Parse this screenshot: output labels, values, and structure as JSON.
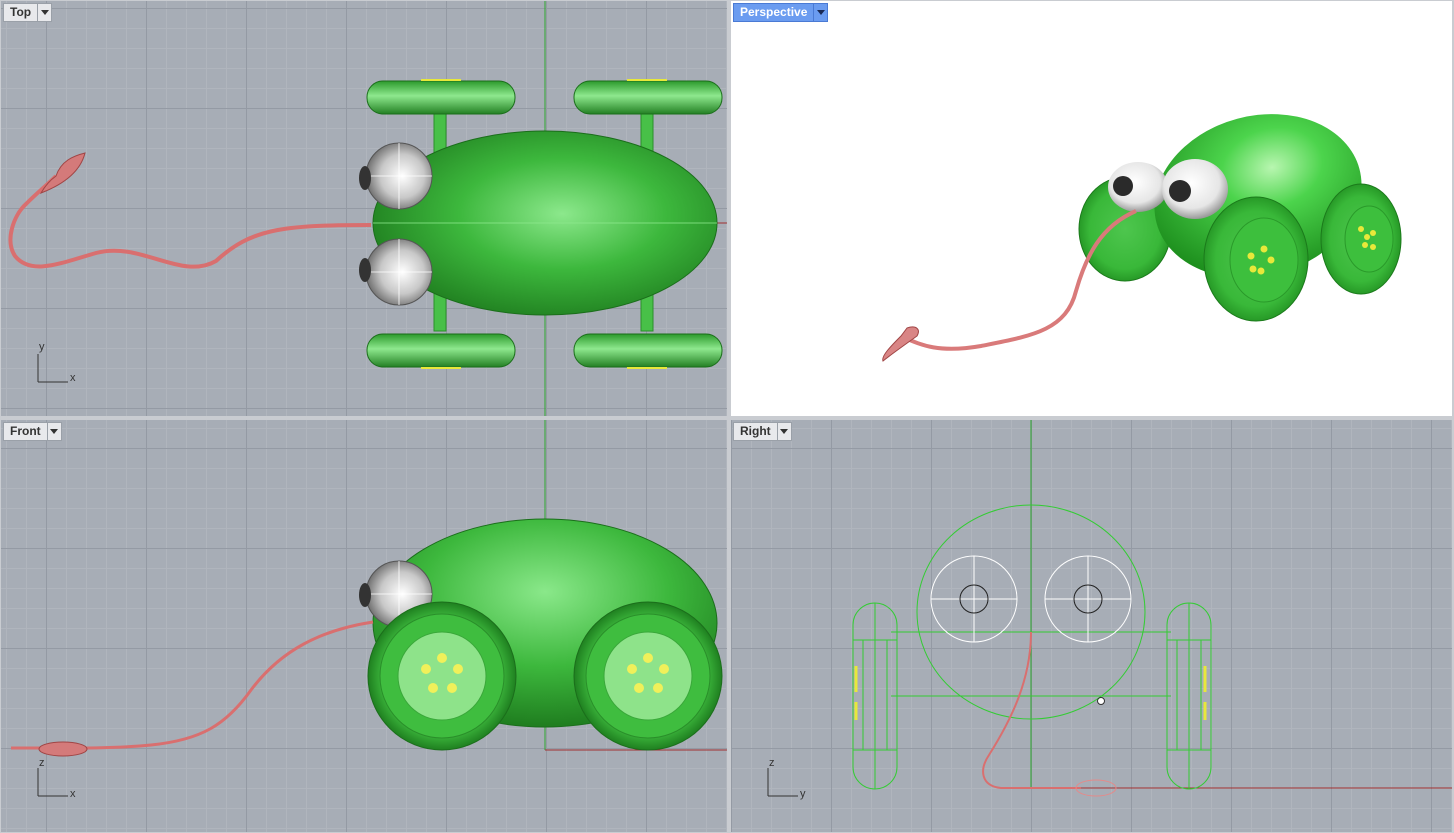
{
  "viewports": {
    "top": {
      "label": "Top",
      "axis_h": "x",
      "axis_v": "y"
    },
    "persp": {
      "label": "Perspective",
      "active": true
    },
    "front": {
      "label": "Front",
      "axis_h": "x",
      "axis_v": "z"
    },
    "right": {
      "label": "Right",
      "axis_h": "y",
      "axis_v": "z"
    }
  },
  "colors": {
    "body_green": "#3cbc3c",
    "wireframe_green": "#33cc33",
    "tail_pink": "#e07a7a",
    "viewport_grid": "#a7adb6",
    "active_tab": "#6b9cf0"
  },
  "icons": [
    "viewport-menu-arrow-icon",
    "axis-gizmo-icon"
  ]
}
